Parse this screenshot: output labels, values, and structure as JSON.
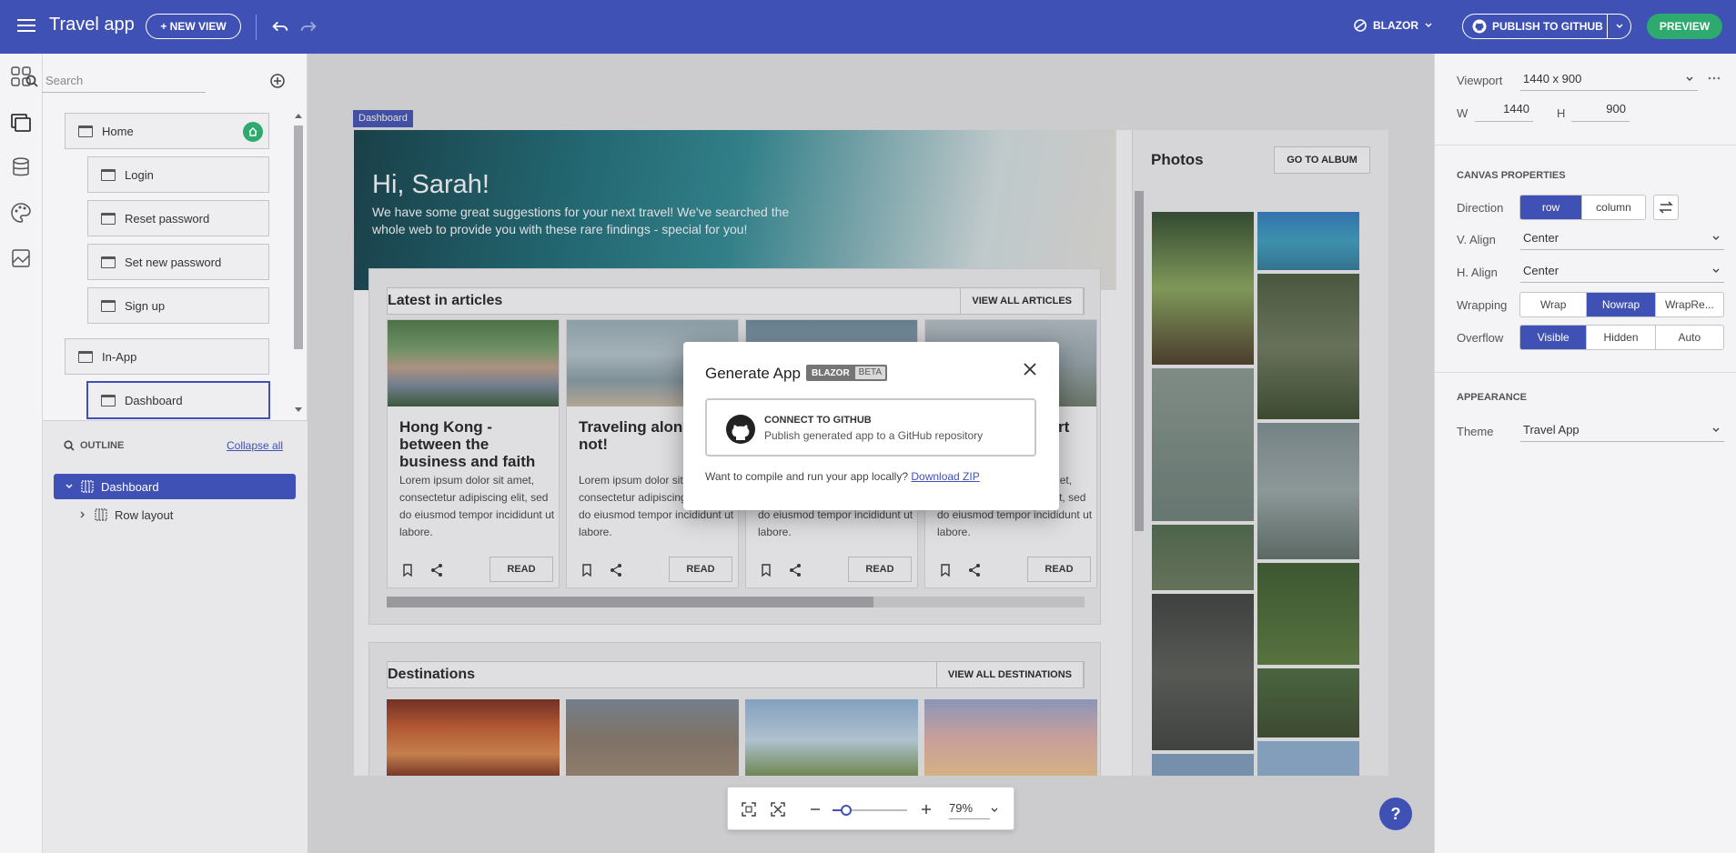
{
  "topbar": {
    "app_title": "Travel app",
    "new_view_label": "+ NEW VIEW",
    "framework_label": "BLAZOR",
    "publish_label": "PUBLISH TO GITHUB",
    "preview_label": "PREVIEW"
  },
  "pages": {
    "search_placeholder": "Search",
    "items": [
      {
        "label": "Home"
      },
      {
        "label": "Login"
      },
      {
        "label": "Reset password"
      },
      {
        "label": "Set new password"
      },
      {
        "label": "Sign up"
      },
      {
        "label": "In-App"
      },
      {
        "label": "Dashboard"
      }
    ]
  },
  "outline": {
    "title": "OUTLINE",
    "collapse_all": "Collapse all",
    "tree": [
      {
        "label": "Dashboard"
      },
      {
        "label": "Row layout"
      }
    ]
  },
  "canvas": {
    "frame_tag": "Dashboard",
    "hero_title": "Hi, Sarah!",
    "hero_subtitle": "We have some great suggestions for your next travel! We've searched the whole web to provide you with these rare findings - special for you!",
    "articles": {
      "title": "Latest in articles",
      "button": "VIEW ALL ARTICLES",
      "cards": [
        {
          "title": "Hong Kong - between the business and faith",
          "body": "Lorem ipsum dolor sit amet, consectetur adipiscing elit, sed do eiusmod tempor incididunt ut labore.",
          "read": "READ"
        },
        {
          "title": "Traveling alone. Why not!",
          "body": "Lorem ipsum dolor sit amet, consectetur adipiscing elit, sed do eiusmod tempor incididunt ut labore.",
          "read": "READ"
        },
        {
          "title": "",
          "body": "Lorem ipsum dolor sit amet, consectetur adipiscing elit, sed do eiusmod tempor incididunt ut labore.",
          "read": "READ"
        },
        {
          "title": "rt",
          "body": "Lorem ipsum dolor sit amet, consectetur adipiscing elit, sed do eiusmod tempor incididunt ut labore.",
          "read": "READ"
        }
      ]
    },
    "destinations": {
      "title": "Destinations",
      "button": "VIEW ALL DESTINATIONS"
    },
    "photos": {
      "title": "Photos",
      "button": "GO TO ALBUM"
    }
  },
  "zoom": {
    "value": "79%",
    "level_fraction": 0.17
  },
  "help_label": "?",
  "right_panel": {
    "viewport_label": "Viewport",
    "viewport_value": "1440 x 900",
    "w_label": "W",
    "w_value": "1440",
    "h_label": "H",
    "h_value": "900",
    "canvas_section": "CANVAS PROPERTIES",
    "direction_label": "Direction",
    "direction_options": [
      "row",
      "column"
    ],
    "valign_label": "V. Align",
    "valign_value": "Center",
    "halign_label": "H. Align",
    "halign_value": "Center",
    "wrapping_label": "Wrapping",
    "wrapping_options": [
      "Wrap",
      "Nowrap",
      "WrapRe..."
    ],
    "overflow_label": "Overflow",
    "overflow_options": [
      "Visible",
      "Hidden",
      "Auto"
    ],
    "appearance_section": "APPEARANCE",
    "theme_label": "Theme",
    "theme_value": "Travel App"
  },
  "modal": {
    "title": "Generate App",
    "badge": "BLAZOR",
    "badge_beta": "BETA",
    "connect_title": "CONNECT TO GITHUB",
    "connect_desc": "Publish generated app to a GitHub repository",
    "footer_text": "Want to compile and run your app locally?",
    "download_link": "Download ZIP"
  },
  "colors": {
    "accent": "#3f51b5",
    "success": "#2eaa6e"
  }
}
